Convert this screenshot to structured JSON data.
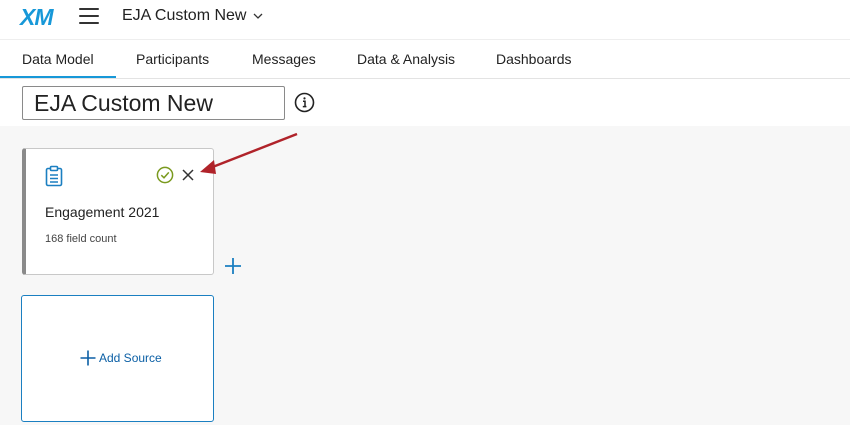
{
  "header": {
    "logo_text": "XM",
    "project_name": "EJA Custom New",
    "brand_color": "#1798d8"
  },
  "tabs": [
    {
      "label": "Data Model",
      "active": true
    },
    {
      "label": "Participants",
      "active": false
    },
    {
      "label": "Messages",
      "active": false
    },
    {
      "label": "Data & Analysis",
      "active": false
    },
    {
      "label": "Dashboards",
      "active": false
    }
  ],
  "title_field": {
    "value": "EJA Custom New"
  },
  "source_card": {
    "title": "Engagement 2021",
    "count_text": "168 field count",
    "status": "check-icon"
  },
  "add_source": {
    "label": "Add Source"
  },
  "colors": {
    "accent": "#1798d8",
    "link": "#0b5fa5",
    "check": "#7a9a1e",
    "annotation_arrow": "#b0232a"
  }
}
